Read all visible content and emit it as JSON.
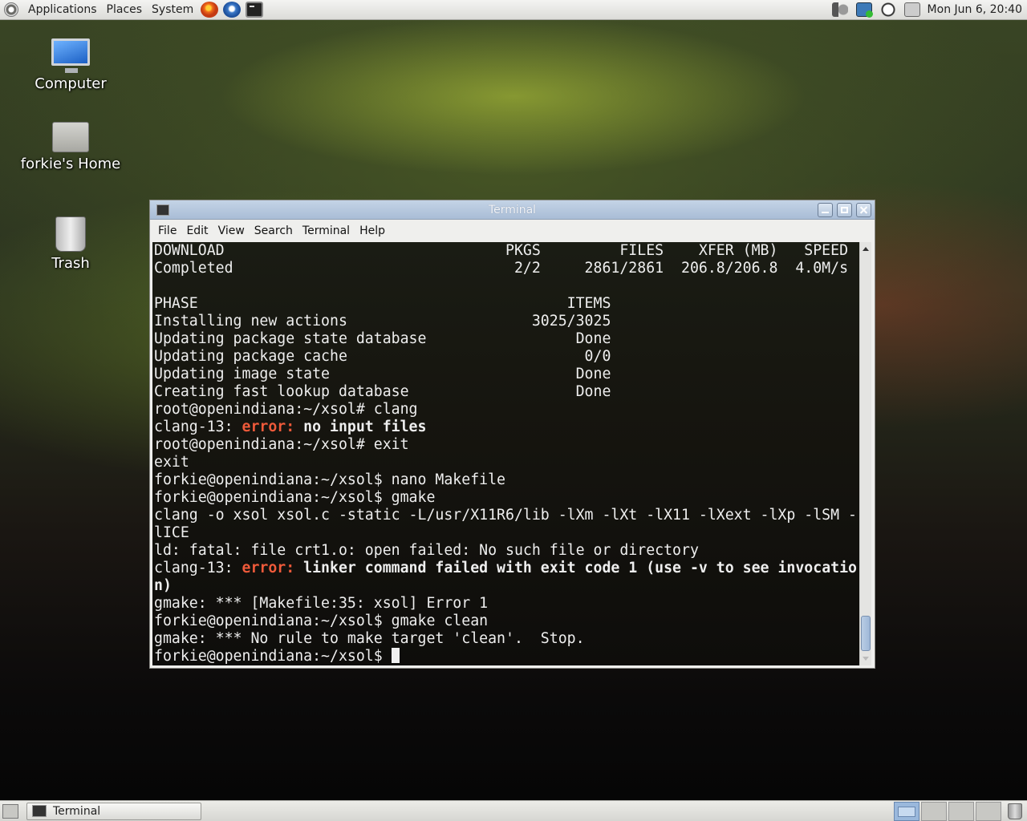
{
  "top_panel": {
    "menus": [
      "Applications",
      "Places",
      "System"
    ],
    "launchers": [
      "firefox-icon",
      "thunderbird-icon",
      "terminal-icon"
    ],
    "tray_icons": [
      "volume-icon",
      "network-icon",
      "clock-applet-icon",
      "window-icon"
    ],
    "clock": "Mon Jun  6, 20:40"
  },
  "desktop": {
    "icons": [
      {
        "label": "Computer",
        "icon": "computer-icon"
      },
      {
        "label": "forkie's Home",
        "icon": "home-folder-icon"
      },
      {
        "label": "Trash",
        "icon": "trash-icon"
      }
    ]
  },
  "terminal": {
    "title": "Terminal",
    "menu": [
      "File",
      "Edit",
      "View",
      "Search",
      "Terminal",
      "Help"
    ],
    "lines": [
      [
        {
          "t": "DOWNLOAD                                PKGS         FILES    XFER (MB)   SPEED"
        }
      ],
      [
        {
          "t": "Completed                                2/2     2861/2861  206.8/206.8  4.0M/s"
        }
      ],
      [
        {
          "t": ""
        }
      ],
      [
        {
          "t": "PHASE                                          ITEMS"
        }
      ],
      [
        {
          "t": "Installing new actions                     3025/3025"
        }
      ],
      [
        {
          "t": "Updating package state database                 Done"
        }
      ],
      [
        {
          "t": "Updating package cache                           0/0"
        }
      ],
      [
        {
          "t": "Updating image state                            Done"
        }
      ],
      [
        {
          "t": "Creating fast lookup database                   Done"
        }
      ],
      [
        {
          "t": "root@openindiana:~/xsol# clang"
        }
      ],
      [
        {
          "t": "clang-13: "
        },
        {
          "t": "error: ",
          "s": "err"
        },
        {
          "t": "no input files",
          "s": "bold"
        }
      ],
      [
        {
          "t": "root@openindiana:~/xsol# exit"
        }
      ],
      [
        {
          "t": "exit"
        }
      ],
      [
        {
          "t": "forkie@openindiana:~/xsol$ nano Makefile"
        }
      ],
      [
        {
          "t": "forkie@openindiana:~/xsol$ gmake"
        }
      ],
      [
        {
          "t": "clang -o xsol xsol.c -static -L/usr/X11R6/lib -lXm -lXt -lX11 -lXext -lXp -lSM -"
        }
      ],
      [
        {
          "t": "lICE"
        }
      ],
      [
        {
          "t": "ld: fatal: file crt1.o: open failed: No such file or directory"
        }
      ],
      [
        {
          "t": "clang-13: "
        },
        {
          "t": "error: ",
          "s": "err"
        },
        {
          "t": "linker command failed with exit code 1 (use -v to see invocatio",
          "s": "bold"
        }
      ],
      [
        {
          "t": "n)",
          "s": "bold"
        }
      ],
      [
        {
          "t": "gmake: *** [Makefile:35: xsol] Error 1"
        }
      ],
      [
        {
          "t": "forkie@openindiana:~/xsol$ gmake clean"
        }
      ],
      [
        {
          "t": "gmake: *** No rule to make target 'clean'.  Stop."
        }
      ],
      [
        {
          "t": "forkie@openindiana:~/xsol$ "
        },
        {
          "t": "",
          "s": "cursor"
        }
      ]
    ]
  },
  "bottom_panel": {
    "task_label": "Terminal",
    "workspaces": 4,
    "active_workspace": 1
  },
  "colors": {
    "error": "#ef5a3a",
    "terminal_fg": "#eeeeee",
    "title_bar": "#b4c6dc"
  }
}
